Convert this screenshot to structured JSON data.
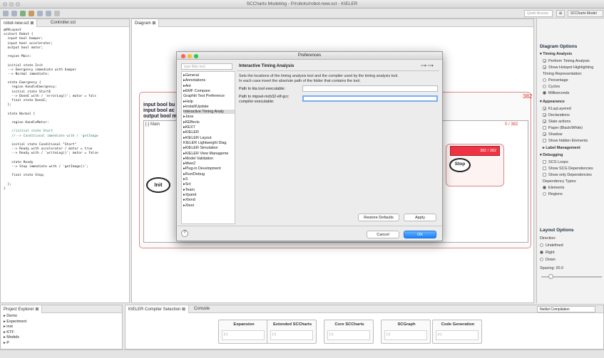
{
  "window": {
    "title": "SCCharts Modeling - P/robots/robot-new.sct - KIELER"
  },
  "toolbar": {
    "quick_access": "Quick Access",
    "perspective": "SCCharts Model"
  },
  "editor_tabs": [
    {
      "label": "robot-new.sct ⊠"
    },
    {
      "label": "Controller.sct"
    }
  ],
  "code_lines": [
    "@VHLayout",
    "scchart Robot {",
    "  input bool bumper;",
    "  input bool accelerator;",
    "  output bool motor;",
    "",
    "  region Main:",
    "",
    "  initial state Init",
    "  --> Emergency immediate with bumper",
    "  --> Normal immediate;",
    "",
    "  state Emergency {",
    "    region HandleEmergency:",
    "    initial state StartE",
    "    --> DoneE with / 'errorLog()'; motor = fals",
    "    final state DoneE;",
    "  };",
    "",
    "  state Normal {",
    "",
    "    region HandleMotor:",
    "",
    "    //initial state Start",
    "    //--> Conditional immediate with / 'getImage",
    "",
    "    initial state Conditional \"Start\"",
    "    --> Ready with accelerator / motor = true",
    "    --> Ready with / 'writeLog()'; motor = false",
    "",
    "    state Ready",
    "    --> Stop immediate with / 'getImage()';",
    "",
    "    final state Stop;",
    "",
    "  };",
    "}"
  ],
  "diagram": {
    "tab": "Diagram ⊠",
    "decl1": "input bool bu",
    "decl2": "input bool ac",
    "decl3": "output bool m",
    "region": "[-] Main",
    "count_outer": "382",
    "count_inner": "0 / 382",
    "count_normal": "382 / 382",
    "init": "Init",
    "stop": "Stop"
  },
  "options": {
    "title": "Diagram Options",
    "timing": "Timing Analysis",
    "perform": "Perform Timing Analysis",
    "hotspot": "Show Hotspot Highlighting",
    "repr": "Timing Representation:",
    "percentage": "Percentage",
    "cycles": "Cycles",
    "ms": "Milliseconds",
    "appearance": "Appearance",
    "klay": "KLayLayered",
    "decls": "Declarations",
    "stateact": "State actions",
    "paper": "Paper (Black/White)",
    "shadow": "Shadow",
    "hidden": "Show hidden Elements",
    "labelmgmt": "Label Management",
    "debugging": "Debugging",
    "scgloops": "SCG Loops",
    "scgdep": "Show SCG Dependencies",
    "onlydep": "Show only Dependencies",
    "deptypes": "Dependency Types:",
    "elements": "Elements",
    "regions": "Regions",
    "layout": "Layout Options",
    "direction": "Direction:",
    "undefined": "Undefined",
    "right": "Right",
    "down": "Down",
    "spacing": "Spacing: 20.0"
  },
  "dialog": {
    "title": "Preferences",
    "filter_placeholder": "type filter text",
    "tree": [
      "▸General",
      "▸Annotations",
      "▸Ant",
      "▸EMF Compare",
      "  Graphiti Test Preference",
      "▸Help",
      "▸Install/Update",
      "  Interactive Timing Analy",
      "▸Java",
      "▸KEffects",
      "▸KEXT",
      "▸KIELER",
      "▸KIELER Layout",
      "  KIELER Lightweight Diag",
      "▸KIELER Simulation",
      "▸KIELER View Manageme",
      "▸Model Validation",
      "▸Mwe2",
      "▸Plug-in Development",
      "▸Run/Debug",
      "▸S",
      "▸Sct",
      "▸Team",
      "▸Xpand",
      "▸Xtend",
      "▸Xtext"
    ],
    "page_title": "Interactive Timing Analysis",
    "desc1": "Sets the locations of the timing analysis tool and the compiler used by the timing analysis tool.",
    "desc2": "In each case insert the absolute path of the folder that contains the tool.",
    "kta_label": "Path to kta tool executable:",
    "gcc_label": "Path to mipsel-mcb32-elf-gcc",
    "gcc_label2": "compiler executable:",
    "restore": "Restore Defaults",
    "apply": "Apply",
    "cancel": "Cancel",
    "ok": "OK",
    "help": "?"
  },
  "bottom": {
    "project_tab": "Project Explorer ⊠",
    "projects": [
      "▸ Demo",
      "▸ Experiment",
      "▸ inst",
      "▸ KTF",
      "▸ Models",
      "▸ P"
    ],
    "compiler_tab": "KIELER Compiler Selection ⊠",
    "console_tab": "Console",
    "stages": [
      "Expansion",
      "Extended SCCharts",
      "Core SCCharts",
      "SCGraph",
      "Code Generation"
    ],
    "stage_inner": "[+]",
    "netlist": "Netlist Compilation"
  }
}
